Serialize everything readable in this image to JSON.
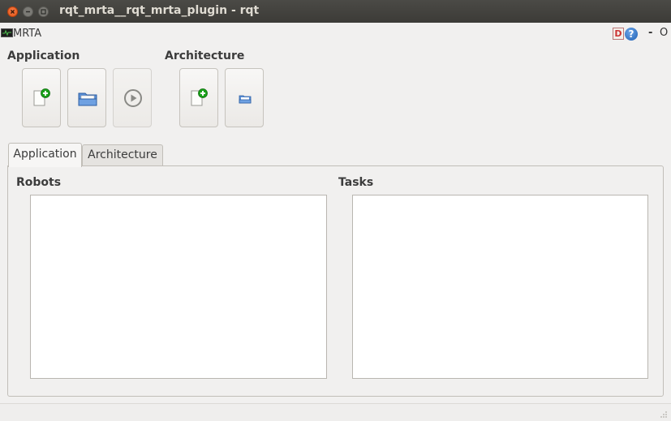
{
  "window": {
    "title": "rqt_mrta__rqt_mrta_plugin - rqt"
  },
  "plugin": {
    "title": "MRTA",
    "d_label": "D",
    "help_label": "?",
    "minimize_label": "-",
    "float_label": "O"
  },
  "toolbar": {
    "application_label": "Application",
    "architecture_label": "Architecture",
    "application_buttons": [
      {
        "icon": "new-document-icon",
        "enabled": true
      },
      {
        "icon": "open-folder-icon",
        "enabled": true
      },
      {
        "icon": "play-icon",
        "enabled": false
      }
    ],
    "architecture_buttons": [
      {
        "icon": "new-document-icon",
        "enabled": true
      },
      {
        "icon": "open-folder-icon",
        "enabled": true
      }
    ]
  },
  "tabs": [
    {
      "label": "Application",
      "active": true
    },
    {
      "label": "Architecture",
      "active": false
    }
  ],
  "panel": {
    "robots_label": "Robots",
    "tasks_label": "Tasks",
    "robots": [],
    "tasks": []
  },
  "colors": {
    "titlebar": "#3c3b37",
    "close_button": "#e25514",
    "window_bg": "#f1f0ef",
    "add_green": "#1aa01a"
  }
}
